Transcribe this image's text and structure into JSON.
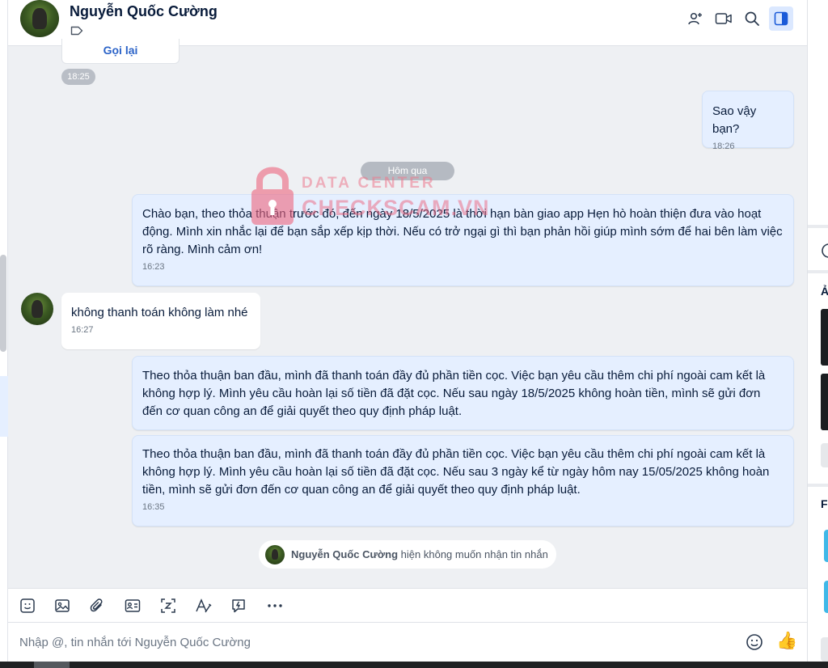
{
  "header": {
    "contact_name": "Nguyễn Quốc Cường",
    "icons": [
      "add-member-icon",
      "video-call-icon",
      "search-icon",
      "toggle-panel-icon"
    ]
  },
  "messages": {
    "callback_label": "Gọi lại",
    "callback_time": "18:25",
    "m1": {
      "text": "Sao vậy bạn?",
      "time": "18:26"
    },
    "day_divider": "Hôm qua",
    "m2": {
      "text": "Chào bạn, theo thỏa thuận trước đó, đến ngày 18/5/2025 là thời hạn bàn giao app Hẹn hò hoàn thiện đưa vào hoạt động. Mình xin nhắc lại để bạn sắp xếp kịp thời. Nếu có trở ngại gì thì bạn phản hồi giúp mình sớm để hai bên làm việc rõ ràng. Mình cảm ơn!",
      "time": "16:23"
    },
    "m3": {
      "text": "không thanh toán không làm nhé",
      "time": "16:27"
    },
    "m4": {
      "text": "Theo thỏa thuận ban đầu, mình đã thanh toán đầy đủ phần tiền cọc. Việc bạn yêu cầu thêm chi phí ngoài cam kết là không hợp lý. Mình yêu cầu hoàn lại số tiền đã đặt cọc. Nếu sau ngày 18/5/2025 không hoàn tiền, mình sẽ gửi đơn đến cơ quan công an để giải quyết theo quy định pháp luật."
    },
    "m5": {
      "text": "Theo thỏa thuận ban đầu, mình đã thanh toán đầy đủ phần tiền cọc. Việc bạn yêu cầu thêm chi phí ngoài cam kết là không hợp lý. Mình yêu cầu hoàn lại số tiền đã đặt cọc. Nếu sau 3 ngày kể từ ngày hôm nay 15/05/2025 không hoàn tiền, mình sẽ gửi đơn đến cơ quan công an để giải quyết theo quy định pháp luật.",
      "time": "16:35"
    },
    "notice_name": "Nguyễn Quốc Cường",
    "notice_text": "hiện không muốn nhận tin nhắn"
  },
  "watermark": {
    "line1": "DATA CENTER",
    "line2": "CHECKSCAM.VN"
  },
  "toolbar": {
    "icons": [
      "sticker-icon",
      "image-icon",
      "attachment-icon",
      "contact-card-icon",
      "screenshot-icon",
      "text-format-icon",
      "quick-message-icon",
      "more-icon"
    ]
  },
  "composer": {
    "placeholder": "Nhập @, tin nhắn tới Nguyễn Quốc Cường"
  },
  "right_panel": {
    "partial_chars": [
      "Ả",
      "Fi"
    ]
  },
  "colors": {
    "my_bubble": "#e5efff",
    "their_bubble": "#ffffff",
    "accent": "#2b63c8",
    "background": "#eef0f3"
  }
}
